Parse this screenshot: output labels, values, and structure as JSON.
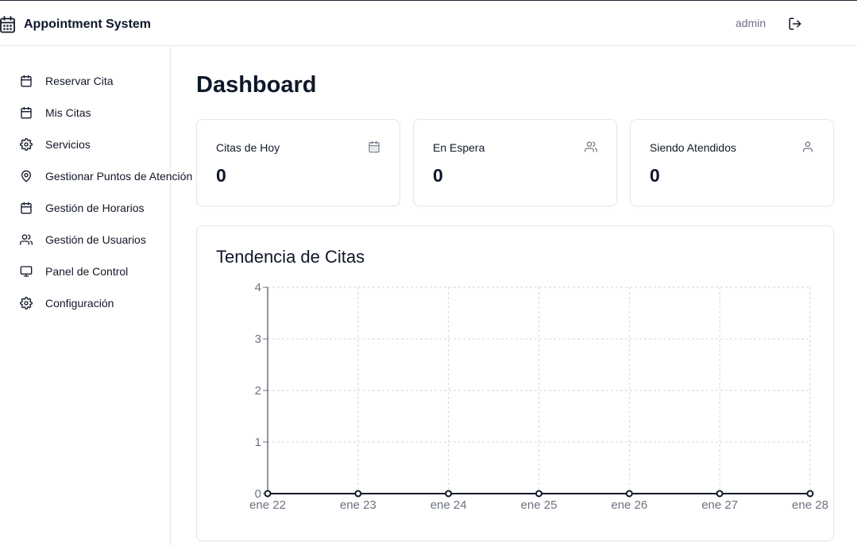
{
  "app": {
    "title": "Appointment System"
  },
  "user": {
    "name": "admin"
  },
  "sidebar": {
    "items": [
      {
        "label": "Reservar Cita",
        "icon": "calendar-icon"
      },
      {
        "label": "Mis Citas",
        "icon": "calendar-icon"
      },
      {
        "label": "Servicios",
        "icon": "gear-icon"
      },
      {
        "label": "Gestionar Puntos de Atención",
        "icon": "map-pin-icon"
      },
      {
        "label": "Gestión de Horarios",
        "icon": "calendar-icon"
      },
      {
        "label": "Gestión de Usuarios",
        "icon": "users-icon"
      },
      {
        "label": "Panel de Control",
        "icon": "monitor-icon"
      },
      {
        "label": "Configuración",
        "icon": "gear-icon"
      }
    ]
  },
  "main": {
    "title": "Dashboard",
    "cards": [
      {
        "label": "Citas de Hoy",
        "value": "0",
        "icon": "calendar-days-icon"
      },
      {
        "label": "En Espera",
        "value": "0",
        "icon": "users-icon"
      },
      {
        "label": "Siendo Atendidos",
        "value": "0",
        "icon": "user-icon"
      }
    ],
    "chart_title": "Tendencia de Citas"
  },
  "chart_data": {
    "type": "line",
    "title": "Tendencia de Citas",
    "categories": [
      "ene 22",
      "ene 23",
      "ene 24",
      "ene 25",
      "ene 26",
      "ene 27",
      "ene 28"
    ],
    "values": [
      0,
      0,
      0,
      0,
      0,
      0,
      0
    ],
    "yticks": [
      "0",
      "1",
      "2",
      "3",
      "4"
    ],
    "ylim": [
      0,
      4
    ],
    "grid": true,
    "xlabel": "",
    "ylabel": "",
    "colors": {
      "line": "#0f172a",
      "grid": "#d1d5db",
      "axis": "#6b7280"
    }
  }
}
